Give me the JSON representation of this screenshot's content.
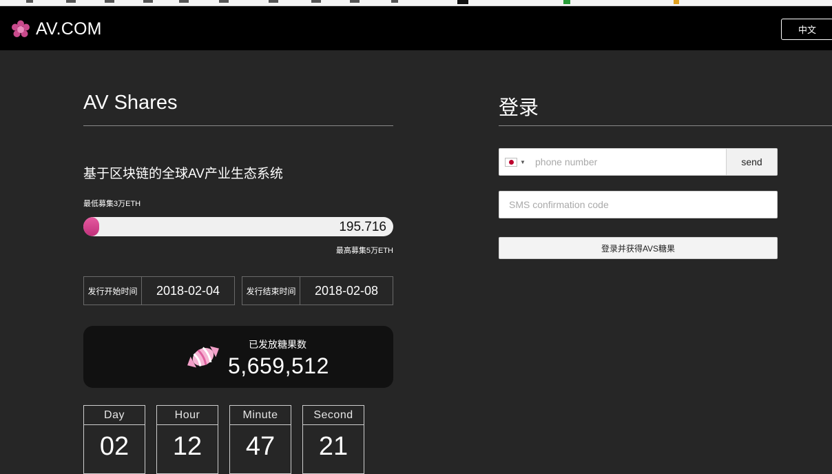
{
  "header": {
    "logo_text": "AV.COM",
    "lang_button": "中文"
  },
  "left": {
    "title": "AV Shares",
    "subtitle": "基于区块链的全球AV产业生态系统",
    "min_raise": "最低募集3万ETH",
    "progress_value": "195.716",
    "progress_fraction": 0.04,
    "max_raise": "最高募集5万ETH",
    "start_label": "发行开始时间",
    "start_date": "2018-02-04",
    "end_label": "发行结束时间",
    "end_date": "2018-02-08",
    "candy_label": "已发放糖果数",
    "candy_count": "5,659,512",
    "countdown": {
      "day_label": "Day",
      "day": "02",
      "hour_label": "Hour",
      "hour": "12",
      "minute_label": "Minute",
      "minute": "47",
      "second_label": "Second",
      "second": "21"
    }
  },
  "right": {
    "title": "登录",
    "phone_placeholder": "phone number",
    "send_label": "send",
    "sms_placeholder": "SMS confirmation code",
    "login_button": "登录并获得AVS糖果"
  },
  "colors": {
    "accent": "#d9468f",
    "header_bg": "#000000",
    "page_bg": "#262626"
  },
  "icons": {
    "logo": "flower-icon",
    "candy": "candy-icon",
    "flag": "japan-flag-icon"
  }
}
